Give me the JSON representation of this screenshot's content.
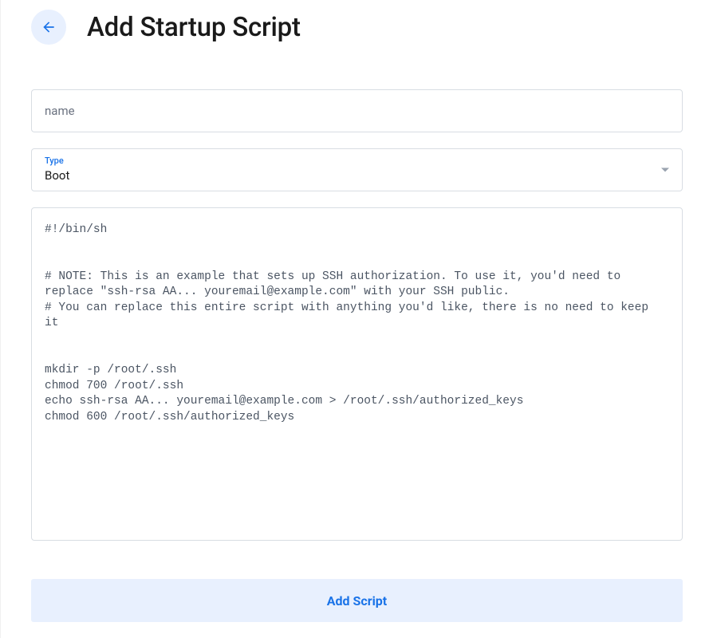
{
  "header": {
    "title": "Add Startup Script"
  },
  "form": {
    "name": {
      "placeholder": "name",
      "value": ""
    },
    "type": {
      "label": "Type",
      "value": "Boot"
    },
    "script": {
      "value": "#!/bin/sh\n\n\n# NOTE: This is an example that sets up SSH authorization. To use it, you'd need to replace \"ssh-rsa AA... youremail@example.com\" with your SSH public.\n# You can replace this entire script with anything you'd like, there is no need to keep it\n\n\nmkdir -p /root/.ssh\nchmod 700 /root/.ssh\necho ssh-rsa AA... youremail@example.com > /root/.ssh/authorized_keys\nchmod 600 /root/.ssh/authorized_keys"
    },
    "submit_label": "Add Script"
  }
}
